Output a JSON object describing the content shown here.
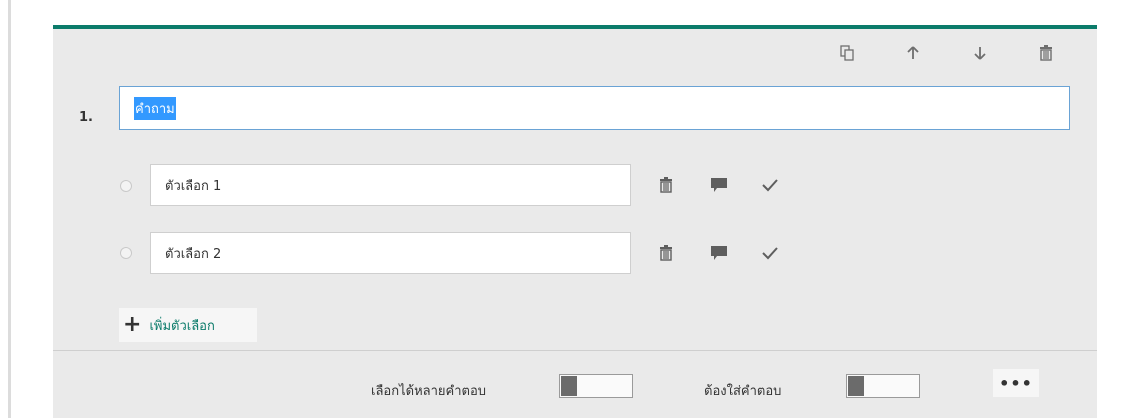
{
  "question": {
    "number": "1.",
    "title_value": "คำถาม"
  },
  "options": [
    {
      "label": "ตัวเลือก 1"
    },
    {
      "label": "ตัวเลือก 2"
    }
  ],
  "add_option_label": "เพิ่มตัวเลือก",
  "footer": {
    "multiple_answers_label": "เลือกได้หลายคำตอบ",
    "multiple_answers_on": false,
    "required_label": "ต้องใส่คำตอบ",
    "required_on": false,
    "more_label": "•••"
  },
  "colors": {
    "accent": "#0b7b6a",
    "card_bg": "#eaeaea",
    "selection": "#3399ff"
  },
  "icons": {
    "toolbar": [
      "copy-icon",
      "arrow-up-icon",
      "arrow-down-icon",
      "trash-icon"
    ],
    "option_actions": [
      "trash-icon",
      "comment-icon",
      "check-icon"
    ]
  }
}
